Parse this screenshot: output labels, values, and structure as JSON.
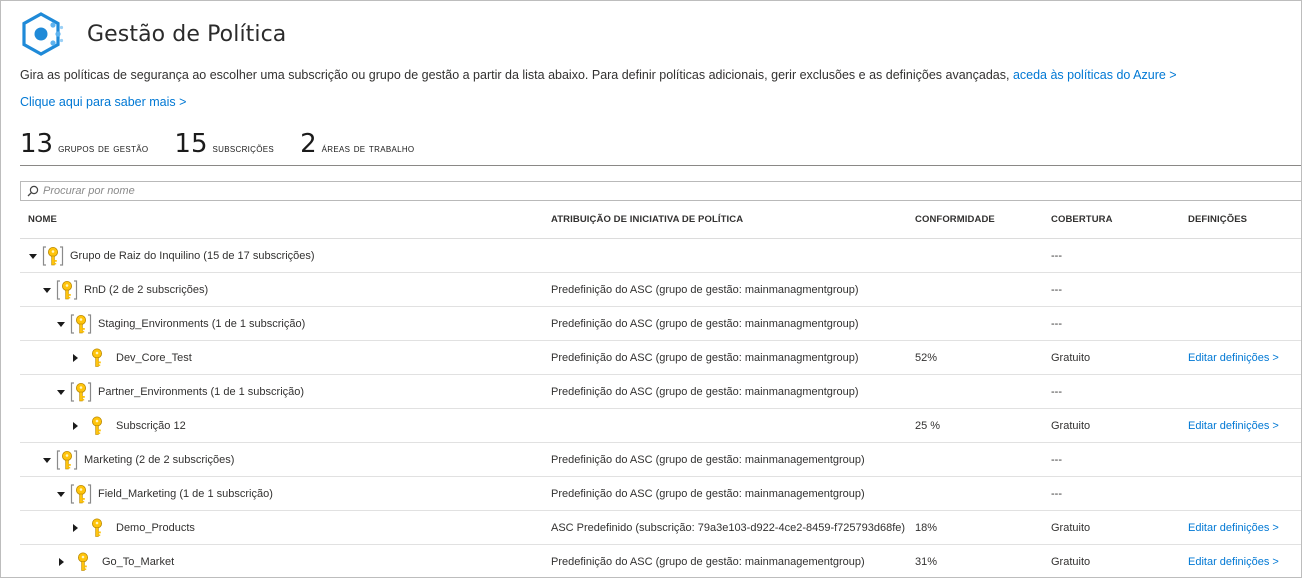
{
  "header": {
    "title": "Gestão de Política",
    "description": "Gira as políticas de segurança ao escolher uma subscrição ou grupo de gestão a partir da lista abaixo. Para definir políticas adicionais, gerir exclusões e as definições avançadas,",
    "azure_link": "aceda às políticas do Azure >",
    "learn_more": "Clique aqui para saber mais >"
  },
  "stats": [
    {
      "count": "13",
      "label": "Grupos de gestão"
    },
    {
      "count": "15",
      "label": "Subscrições"
    },
    {
      "count": "2",
      "label": "Áreas de trabalho"
    }
  ],
  "search": {
    "placeholder": "Procurar por nome"
  },
  "columns": {
    "name": "NOME",
    "policy": "ATRIBUIÇÃO DE INICIATIVA DE POLÍTICA",
    "compliance": "CONFORMIDADE",
    "coverage": "COBERTURA",
    "settings": "DEFINIÇÕES"
  },
  "rows": [
    {
      "name": "Grupo de Raiz do Inquilino (15 de 17 subscrições)",
      "level": 0,
      "kind": "group",
      "expanded": true,
      "policy": "",
      "compliance": "",
      "coverage": "---",
      "settings": ""
    },
    {
      "name": "RnD (2 de 2 subscrições)",
      "level": 1,
      "kind": "group",
      "expanded": true,
      "policy": "Predefinição do ASC (grupo de gestão: mainmanagmentgroup)",
      "compliance": "",
      "coverage": "---",
      "settings": ""
    },
    {
      "name": "Staging_Environments (1 de 1 subscrição)",
      "level": 2,
      "kind": "group",
      "expanded": true,
      "policy": "Predefinição do ASC (grupo de gestão: mainmanagmentgroup)",
      "compliance": "",
      "coverage": "---",
      "settings": ""
    },
    {
      "name": "Dev_Core_Test",
      "level": 3,
      "kind": "subscription",
      "expanded": false,
      "policy": "Predefinição do ASC (grupo de gestão: mainmanagmentgroup)",
      "compliance": "52%",
      "coverage": "Gratuito",
      "settings": "Editar definições >"
    },
    {
      "name": "Partner_Environments (1 de 1 subscrição)",
      "level": 2,
      "kind": "group",
      "expanded": true,
      "policy": "Predefinição do ASC (grupo de gestão: mainmanagmentgroup)",
      "compliance": "",
      "coverage": "---",
      "settings": ""
    },
    {
      "name": "Subscrição 12",
      "level": 3,
      "kind": "subscription",
      "expanded": false,
      "policy": "",
      "compliance": "25 %",
      "coverage": "Gratuito",
      "settings": "Editar definições >"
    },
    {
      "name": "Marketing (2 de 2 subscrições)",
      "level": 1,
      "kind": "group",
      "expanded": true,
      "policy": "Predefinição do ASC (grupo de gestão: mainmanagementgroup)",
      "compliance": "",
      "coverage": "---",
      "settings": ""
    },
    {
      "name": "Field_Marketing (1 de 1 subscrição)",
      "level": 2,
      "kind": "group",
      "expanded": true,
      "policy": "Predefinição do ASC (grupo de gestão: mainmanagementgroup)",
      "compliance": "",
      "coverage": "---",
      "settings": ""
    },
    {
      "name": "Demo_Products",
      "level": 3,
      "kind": "subscription",
      "expanded": false,
      "policy": "ASC Predefinido (subscrição: 79a3e103-d922-4ce2-8459-f725793d68fe)",
      "compliance": "18%",
      "coverage": "Gratuito",
      "settings": "Editar definições >"
    },
    {
      "name": "Go_To_Market",
      "level": 2,
      "kind": "subscription",
      "expanded": false,
      "policy": "Predefinição do ASC (grupo de gestão: mainmanagementgroup)",
      "compliance": "31%",
      "coverage": "Gratuito",
      "settings": "Editar definições >"
    }
  ],
  "colors": {
    "link": "#0078d4",
    "key_fill": "#ffc40c",
    "key_outline": "#b98800",
    "logo_blue": "#1f8ad8"
  }
}
